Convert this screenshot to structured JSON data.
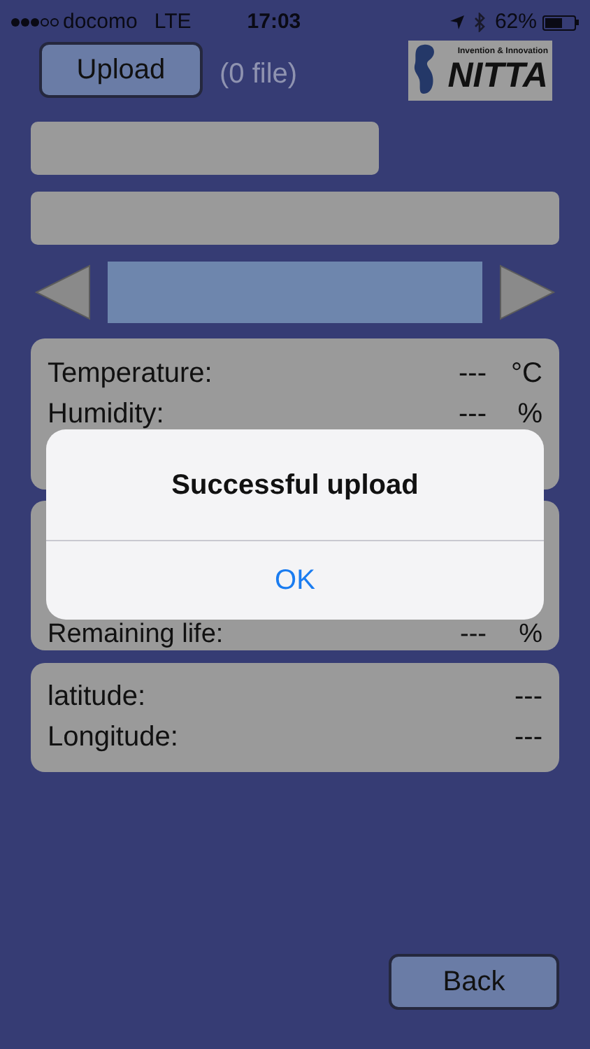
{
  "status_bar": {
    "signal_dots": [
      {
        "filled": true
      },
      {
        "filled": true
      },
      {
        "filled": true
      },
      {
        "filled": false
      },
      {
        "filled": false
      }
    ],
    "carrier": "docomo",
    "network": "LTE",
    "time": "17:03",
    "battery_text": "62%",
    "battery": {
      "level": 0.62
    }
  },
  "upload_button": "Upload",
  "file_count": "(0 file)",
  "logo": {
    "tagline": "Invention & Innovation",
    "name": "NITTA"
  },
  "panels": [
    {
      "rows": [
        {
          "label": "Temperature:",
          "value": "---",
          "unit": "°C"
        },
        {
          "label": "Humidity:",
          "value": "---",
          "unit": "%"
        }
      ]
    },
    {
      "rows": [
        {
          "label": "Remaining life:",
          "value": "---",
          "unit": "%"
        }
      ]
    },
    {
      "rows": [
        {
          "label": "latitude:",
          "value": "---"
        },
        {
          "label": "Longitude:",
          "value": "---"
        }
      ]
    }
  ],
  "back_button": "Back",
  "alert": {
    "title": "Successful upload",
    "button": "OK"
  }
}
